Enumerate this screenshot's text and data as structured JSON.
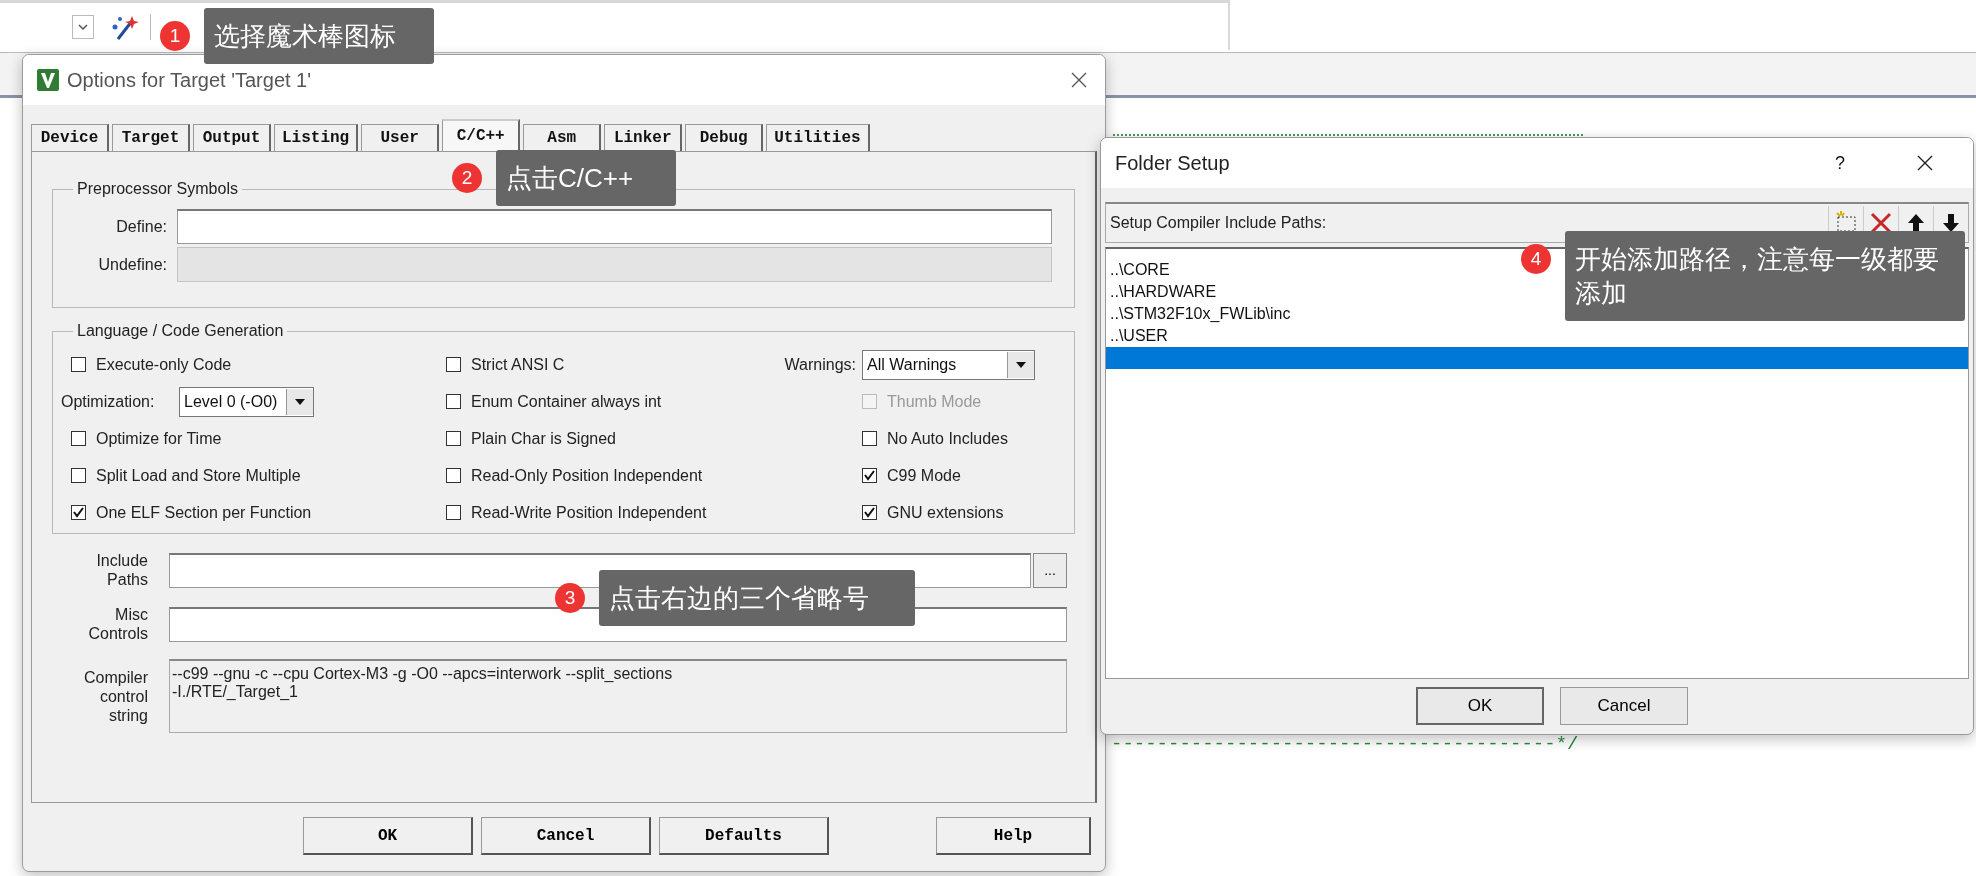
{
  "options_dialog": {
    "title": "Options for Target 'Target 1'",
    "tabs": [
      {
        "label": "Device",
        "selected": false
      },
      {
        "label": "Target",
        "selected": false
      },
      {
        "label": "Output",
        "selected": false
      },
      {
        "label": "Listing",
        "selected": false
      },
      {
        "label": "User",
        "selected": false
      },
      {
        "label": "C/C++",
        "selected": true
      },
      {
        "label": "Asm",
        "selected": false
      },
      {
        "label": "Linker",
        "selected": false
      },
      {
        "label": "Debug",
        "selected": false
      },
      {
        "label": "Utilities",
        "selected": false
      }
    ],
    "preprocessor": {
      "title": "Preprocessor Symbols",
      "fields": [
        {
          "label": "Define:",
          "disabled": false
        },
        {
          "label": "Undefine:",
          "disabled": true
        }
      ]
    },
    "language": {
      "title": "Language / Code Generation",
      "columns": [
        [
          {
            "kind": "checkbox",
            "label": "Execute-only Code",
            "checked": false,
            "disabled": false
          },
          {
            "kind": "dropdown",
            "label": "Optimization:",
            "value": "Level 0 (-O0)"
          },
          {
            "kind": "checkbox",
            "label": "Optimize for Time",
            "checked": false,
            "disabled": false
          },
          {
            "kind": "checkbox",
            "label": "Split Load and Store Multiple",
            "checked": false,
            "disabled": false
          },
          {
            "kind": "checkbox",
            "label": "One ELF Section per Function",
            "checked": true,
            "disabled": false
          }
        ],
        [
          {
            "kind": "checkbox",
            "label": "Strict ANSI C",
            "checked": false,
            "disabled": false
          },
          {
            "kind": "checkbox",
            "label": "Enum Container always int",
            "checked": false,
            "disabled": false
          },
          {
            "kind": "checkbox",
            "label": "Plain Char is Signed",
            "checked": false,
            "disabled": false
          },
          {
            "kind": "checkbox",
            "label": "Read-Only Position Independent",
            "checked": false,
            "disabled": false
          },
          {
            "kind": "checkbox",
            "label": "Read-Write Position Independent",
            "checked": false,
            "disabled": false
          }
        ],
        [
          {
            "kind": "dropdown",
            "label": "Warnings:",
            "value": "All Warnings"
          },
          {
            "kind": "checkbox",
            "label": "Thumb Mode",
            "checked": false,
            "disabled": true
          },
          {
            "kind": "checkbox",
            "label": "No Auto Includes",
            "checked": false,
            "disabled": false
          },
          {
            "kind": "checkbox",
            "label": "C99 Mode",
            "checked": true,
            "disabled": false
          },
          {
            "kind": "checkbox",
            "label": "GNU extensions",
            "checked": true,
            "disabled": false
          }
        ]
      ]
    },
    "include_paths": {
      "label": "Include Paths",
      "button": "..."
    },
    "misc_controls": {
      "label": "Misc Controls"
    },
    "compiler_string": {
      "label": "Compiler control string",
      "lines": [
        "--c99 --gnu -c --cpu Cortex-M3 -g -O0 --apcs=interwork --split_sections",
        "-I./RTE/_Target_1"
      ]
    },
    "buttons": [
      "OK",
      "Cancel",
      "Defaults",
      "Help"
    ]
  },
  "folder_dialog": {
    "title": "Folder Setup",
    "help": "?",
    "header": "Setup Compiler Include Paths:",
    "items": [
      {
        "text": "..\\CORE",
        "selected": false
      },
      {
        "text": "..\\HARDWARE",
        "selected": false
      },
      {
        "text": "..\\STM32F10x_FWLib\\inc",
        "selected": false
      },
      {
        "text": "..\\USER",
        "selected": false
      },
      {
        "selected": true
      }
    ],
    "buttons": [
      "OK",
      "Cancel"
    ]
  },
  "editor": {
    "code_lines": [
      "---------------------------------------*/"
    ]
  },
  "callouts": [
    {
      "number": "1",
      "text": "选择魔术棒图标"
    },
    {
      "number": "2",
      "text": "点击C/C++"
    },
    {
      "number": "3",
      "text": "点击右边的三个省略号"
    },
    {
      "number": "4",
      "text": "开始添加路径，注意每一级都要添加"
    }
  ]
}
